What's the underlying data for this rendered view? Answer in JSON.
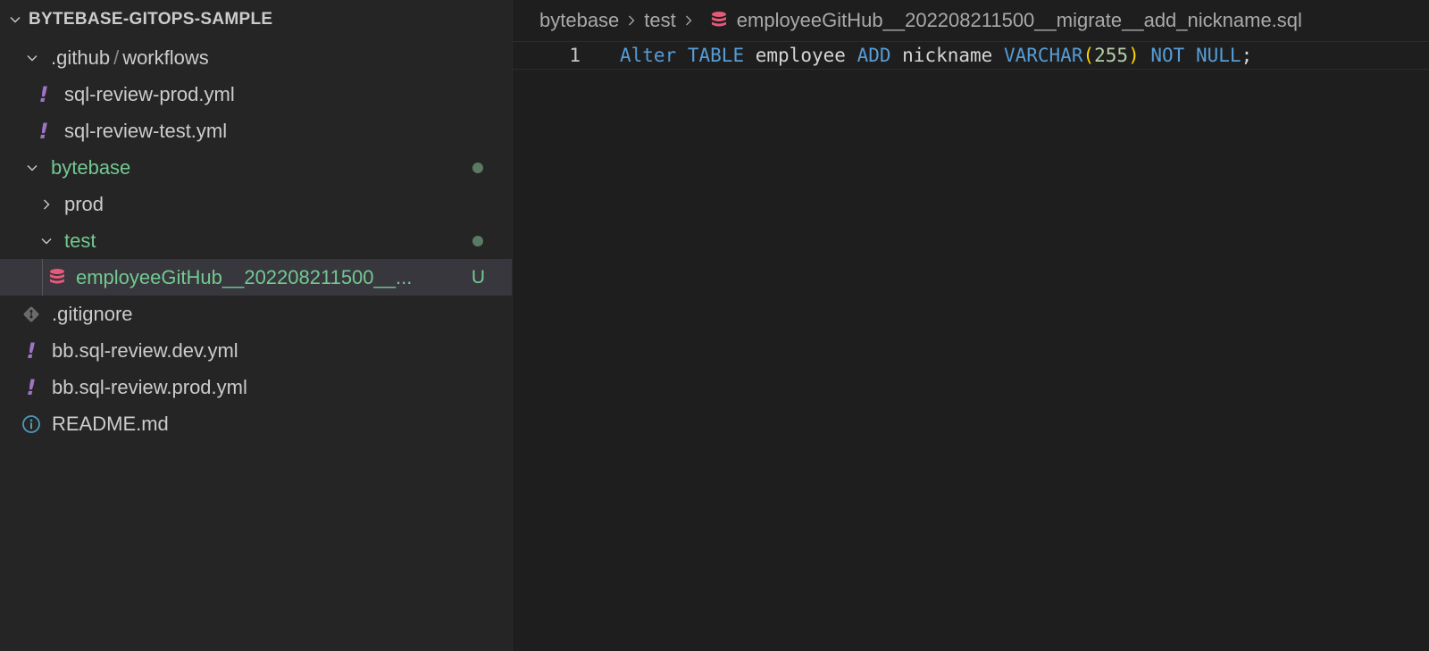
{
  "explorer": {
    "root_title": "BYTEBASE-GITOPS-SAMPLE",
    "items": [
      {
        "label": ".github",
        "label2": "workflows",
        "sep": "/"
      },
      {
        "label": "sql-review-prod.yml",
        "icon_text": "!"
      },
      {
        "label": "sql-review-test.yml",
        "icon_text": "!"
      },
      {
        "label": "bytebase"
      },
      {
        "label": "prod"
      },
      {
        "label": "test"
      },
      {
        "label": "employeeGitHub__202208211500__...",
        "status": "U"
      },
      {
        "label": ".gitignore"
      },
      {
        "label": "bb.sql-review.dev.yml",
        "icon_text": "!"
      },
      {
        "label": "bb.sql-review.prod.yml",
        "icon_text": "!"
      },
      {
        "label": "README.md"
      }
    ]
  },
  "editor": {
    "breadcrumb": [
      "bytebase",
      "test",
      "employeeGitHub__202208211500__migrate__add_nickname.sql"
    ],
    "line_number": "1",
    "tokens": {
      "t1": "Alter",
      "t2": "TABLE",
      "t3": "employee",
      "t4": "ADD",
      "t5": "nickname",
      "t6": "VARCHAR",
      "t7": "(",
      "t8": "255",
      "t9": ")",
      "t10": "NOT",
      "t11": "NULL",
      "t12": ";"
    }
  },
  "colors": {
    "modified_green": "#73c991",
    "yaml_purple": "#a074c4",
    "db_pink": "#e8587a",
    "keyword_blue": "#569cd6"
  }
}
